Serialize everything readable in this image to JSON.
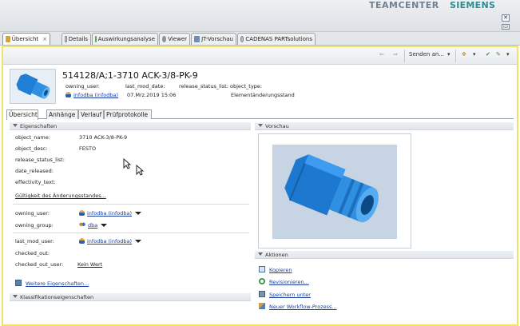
{
  "branding": {
    "teamcenter": "TEAMCENTER",
    "siemens": "SIEMENS"
  },
  "tabs": [
    {
      "label": "Übersicht",
      "icon": "overview-icon",
      "active": true
    },
    {
      "label": "Details",
      "icon": "details-icon"
    },
    {
      "label": "Auswirkungsanalyse",
      "icon": "impact-analysis-icon"
    },
    {
      "label": "Viewer",
      "icon": "viewer-icon"
    },
    {
      "label": "JT-Vorschau",
      "icon": "jt-preview-icon"
    },
    {
      "label": "CADENAS PARTsolutions",
      "icon": "cadenas-icon"
    }
  ],
  "toolbar": {
    "send_to": "Senden an..."
  },
  "object": {
    "title": "514128/A;1-3710 ACK-3/8-PK-9",
    "header_labels": [
      "owning_user:",
      "last_mod_date:",
      "release_status_list:",
      "object_type:"
    ],
    "owning_user": "infodba (infodba)",
    "last_mod_date": "07.Mrz.2019 15:06",
    "object_type": "Elementänderungsstand"
  },
  "subtabs": [
    "Übersicht",
    "Anhänge",
    "Verlauf",
    "Prüfprotokolle"
  ],
  "properties": {
    "heading": "Eigenschaften",
    "rows": [
      {
        "label": "object_name:",
        "value": "3710 ACK-3/8-PK-9"
      },
      {
        "label": "object_desc:",
        "value": "FESTO"
      },
      {
        "label": "release_status_list:",
        "value": ""
      },
      {
        "label": "date_released:",
        "value": ""
      },
      {
        "label": "effectivity_text:",
        "value": ""
      }
    ],
    "validity_link": "Gültigkeit des Änderungsstandes...",
    "owning_user_label": "owning_user:",
    "owning_user_value": "infodba (infodba)",
    "owning_group_label": "owning_group:",
    "owning_group_value": "dba",
    "last_mod_user_label": "last_mod_user:",
    "last_mod_user_value": "infodba (infodba)",
    "checked_out_label": "checked_out:",
    "checked_out_user_label": "checked_out_user:",
    "checked_out_user_value": "Kein Wert",
    "more_link": "Weitere Eigenschaften..."
  },
  "classification": {
    "heading": "Klassifikationseigenschaften"
  },
  "preview": {
    "heading": "Vorschau"
  },
  "actions": {
    "heading": "Aktionen",
    "items": [
      {
        "label": "Kopieren",
        "icon": "copy-icon"
      },
      {
        "label": "Revisionieren...",
        "icon": "revise-icon"
      },
      {
        "label": "Speichern unter",
        "icon": "save-as-icon"
      },
      {
        "label": "Neuer Workflow-Prozess...",
        "icon": "workflow-icon"
      }
    ]
  },
  "colors": {
    "accent_frame": "#f2e266",
    "link": "#1a3da0",
    "part_blue": "#2f8fe0"
  }
}
